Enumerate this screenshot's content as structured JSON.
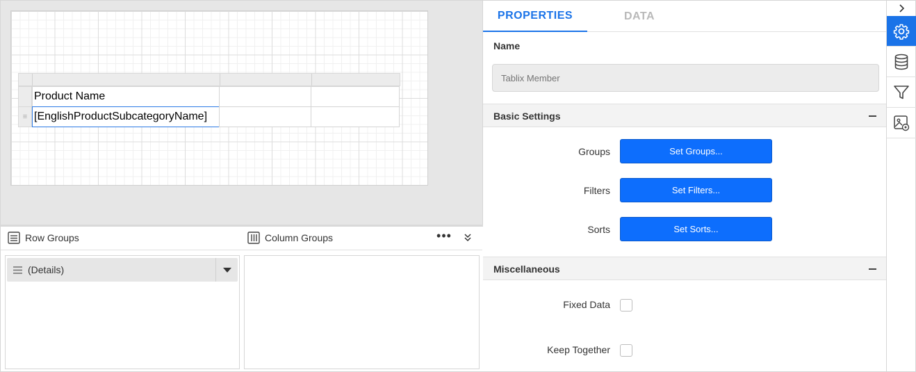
{
  "designer": {
    "tablix": {
      "header_cell": "Product Name",
      "detail_cell": "[EnglishProductSubcategoryName]",
      "row_handle_glyph": "≡"
    }
  },
  "group_panel": {
    "row_groups_label": "Row Groups",
    "column_groups_label": "Column Groups",
    "more_glyph": "•••",
    "row_group_items": [
      "(Details)"
    ]
  },
  "properties": {
    "tabs": [
      {
        "label": "PROPERTIES",
        "active": true
      },
      {
        "label": "DATA",
        "active": false
      }
    ],
    "name_label": "Name",
    "name_placeholder": "Tablix Member",
    "sections": {
      "basic": {
        "title": "Basic Settings",
        "rows": [
          {
            "label": "Groups",
            "button": "Set Groups..."
          },
          {
            "label": "Filters",
            "button": "Set Filters..."
          },
          {
            "label": "Sorts",
            "button": "Set Sorts..."
          }
        ]
      },
      "misc": {
        "title": "Miscellaneous",
        "rows": [
          {
            "label": "Fixed Data",
            "checked": false
          },
          {
            "label": "Keep Together",
            "checked": false
          }
        ]
      }
    }
  },
  "rail": {
    "icons": [
      "chevron-right-icon",
      "gear-icon",
      "database-icon",
      "filter-icon",
      "image-settings-icon"
    ],
    "active_icon": "gear-icon"
  },
  "colors": {
    "accent": "#1a73e8",
    "button_blue": "#0d6efd",
    "inactive_tab": "#b9b9b9"
  }
}
